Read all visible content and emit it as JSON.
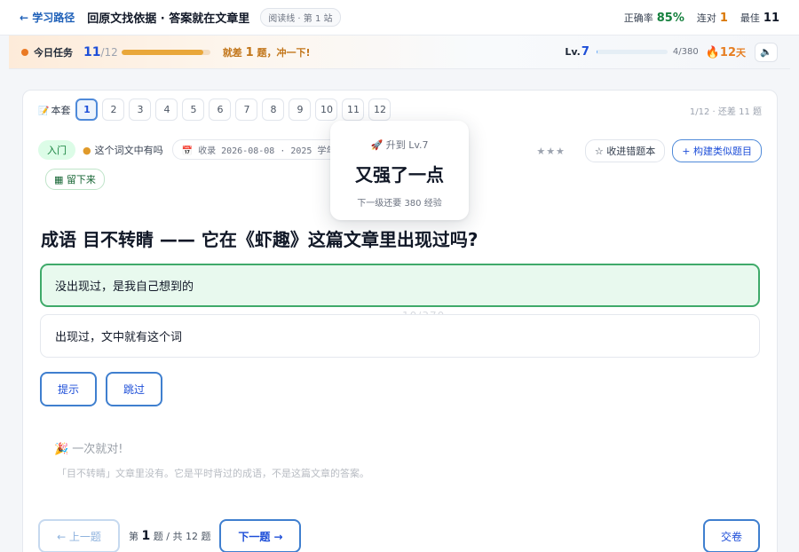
{
  "header": {
    "back": "← 学习路径",
    "title": "回原文找依据 · 答案就在文章里",
    "tag": "阅读线 · 第 1 站",
    "stats": [
      {
        "label": "正确率",
        "value": "85%"
      },
      {
        "label": "连对",
        "value": "1"
      },
      {
        "label": "最佳",
        "value": "11"
      }
    ]
  },
  "task": {
    "label": "今日任务",
    "count": "11",
    "total": "12",
    "progress": 0.92,
    "hint_prefix": "就差",
    "hint_num": "1",
    "hint_suffix": "题，冲一下!",
    "level_prefix": "Lv.",
    "level": "7",
    "xp": "4/380",
    "xp_fraction": 0.01,
    "streak": "🔥12",
    "streak_unit": "天",
    "sound_icon": "🔈"
  },
  "quiz": {
    "set_icon": "📝",
    "set_label": "本套",
    "numbers": [
      "1",
      "2",
      "3",
      "4",
      "5",
      "6",
      "7",
      "8",
      "9",
      "10",
      "11",
      "12"
    ],
    "active_index": 0,
    "progress_text": "1/12 · 还差 11 题",
    "level_badge": "入门",
    "type_icon": "●",
    "type_label": "这个词文中有吗",
    "source": "📅 收录 2026-08-08 · 2025 学年第",
    "stars": "★★★",
    "collect_btn": "☆ 收进错题本",
    "similar_btn": "+ 构建类似题目",
    "keep_btn": "▦ 留下来",
    "question": "成语 目不转睛 —— 它在《虾趣》这篇文章里出现过吗?",
    "options": [
      "没出现过，是我自己想到的",
      "出现过，文中就有这个词"
    ],
    "selected_option": 0,
    "hint_btn": "提示",
    "skip_btn": "跳过",
    "feedback_icon": "🎉",
    "feedback_title": "一次就对!",
    "feedback_text": "「目不转睛」文章里没有。它是平时背过的成语，不是这篇文章的答案。",
    "prev_btn": "← 上一题",
    "page_prefix": "第",
    "page_current": "1",
    "page_suffix": "题 / 共 12 题",
    "next_btn": "下一题 →",
    "submit_btn": "交卷",
    "ghost_text": "10/370"
  },
  "levelup": {
    "top": "🚀 升到 Lv.7",
    "title": "又强了一点",
    "sub": "下一级还要 380 经验"
  }
}
